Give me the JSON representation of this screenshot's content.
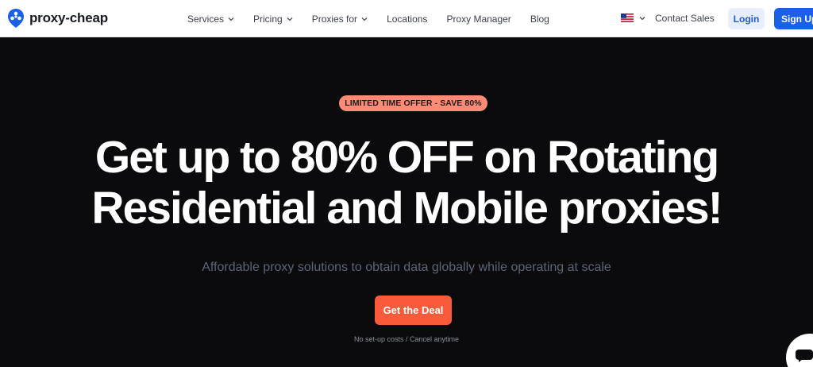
{
  "brand": {
    "name": "proxy-cheap",
    "color": "#1a5fe8"
  },
  "nav": {
    "items": [
      {
        "label": "Services",
        "has_dropdown": true
      },
      {
        "label": "Pricing",
        "has_dropdown": true
      },
      {
        "label": "Proxies for",
        "has_dropdown": true
      },
      {
        "label": "Locations",
        "has_dropdown": false
      },
      {
        "label": "Proxy Manager",
        "has_dropdown": false
      },
      {
        "label": "Blog",
        "has_dropdown": false
      }
    ],
    "language_flag": "us-flag-icon",
    "contact_label": "Contact Sales",
    "login_label": "Login",
    "signup_label": "Sign Up"
  },
  "hero": {
    "badge": "LIMITED TIME OFFER - SAVE 80%",
    "headline_line1": "Get up to 80% OFF on Rotating",
    "headline_line2": "Residential and Mobile proxies!",
    "subtitle": "Affordable proxy solutions to obtain data globally while operating at scale",
    "cta_label": "Get the Deal",
    "note": "No set-up costs / Cancel anytime"
  },
  "colors": {
    "hero_bg": "#0b0b0d",
    "badge_bg": "#ff8b76",
    "cta_bg": "#fa5a3c",
    "primary": "#1a5fe8"
  }
}
